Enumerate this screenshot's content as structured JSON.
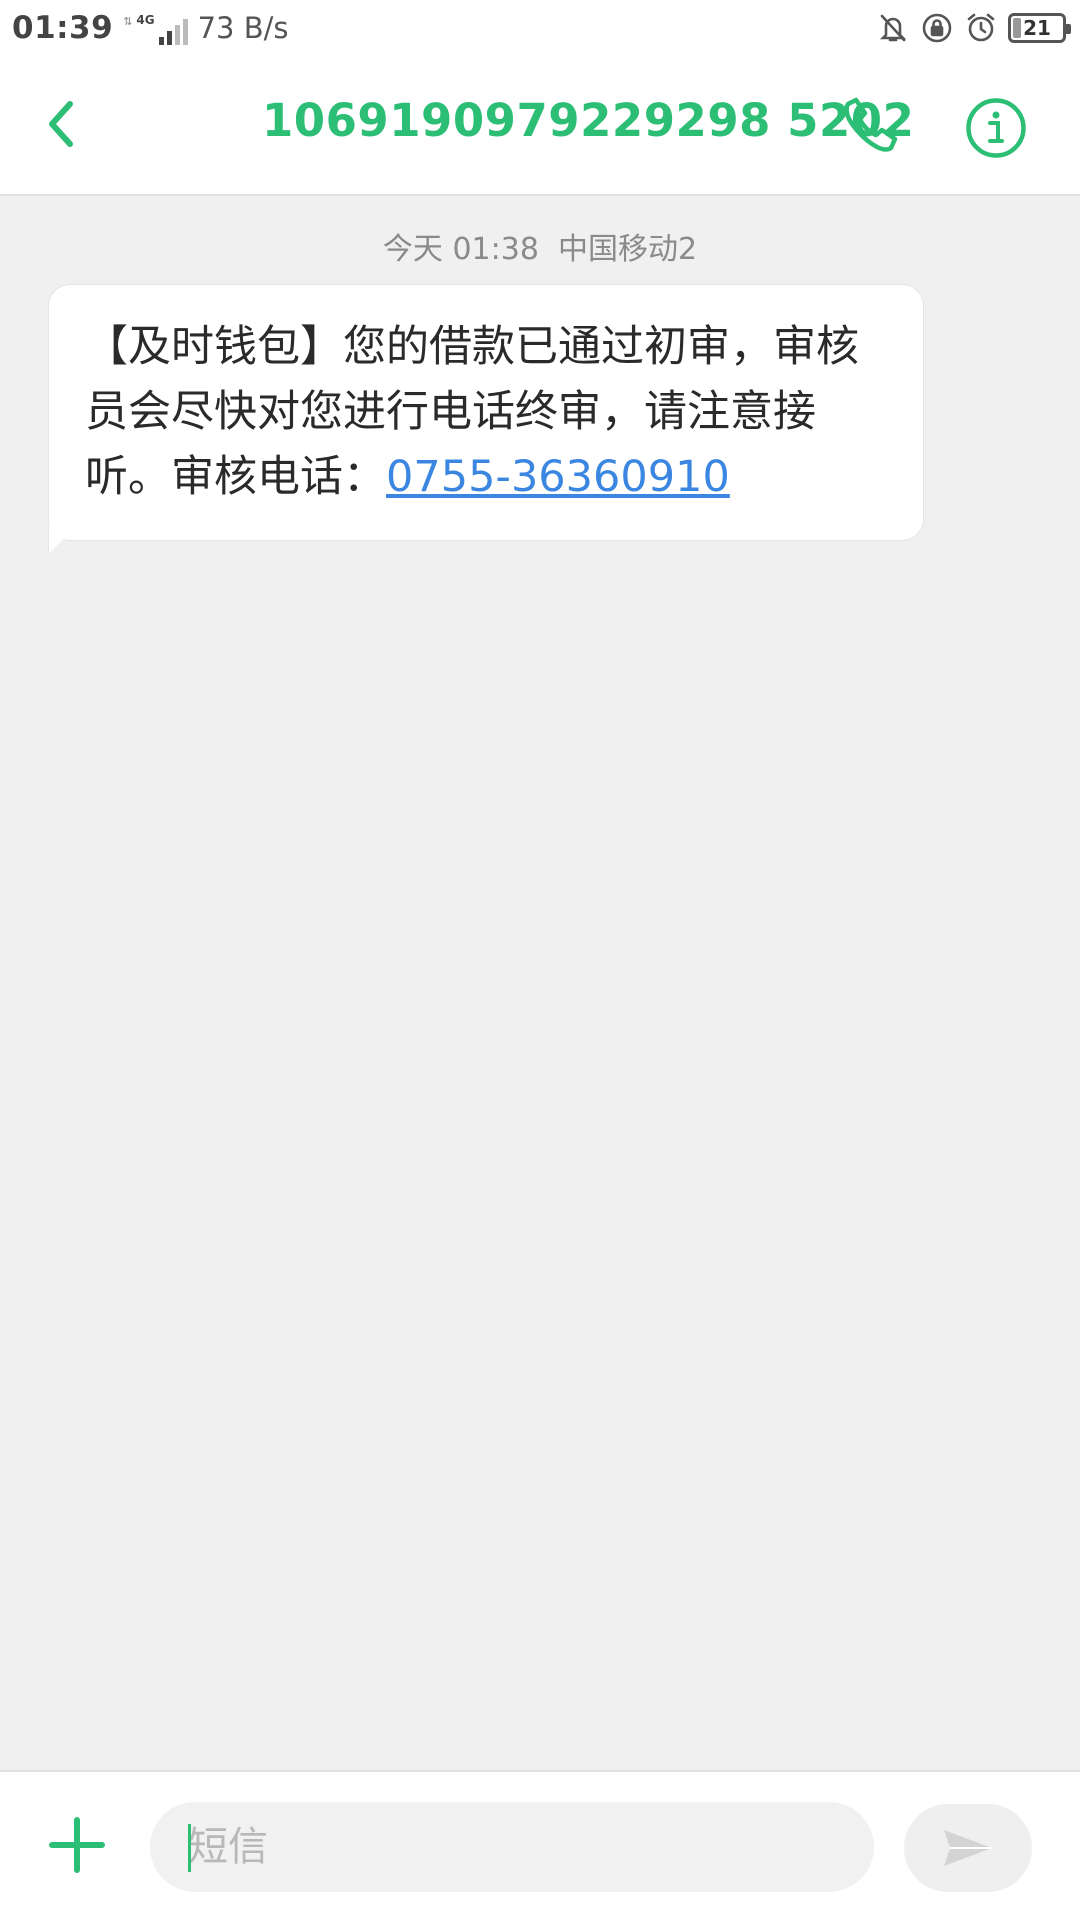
{
  "status_bar": {
    "time": "01:39",
    "network_type": "4G",
    "speed": "73 B/s",
    "battery": "21",
    "icons": [
      "mute-icon",
      "rotation-lock-icon",
      "alarm-icon",
      "battery-icon"
    ]
  },
  "header": {
    "title": "1069190979229298 5202",
    "back_icon": "chevron-left-icon",
    "call_icon": "phone-icon",
    "info_icon": "info-icon",
    "accent_color": "#2dbe76"
  },
  "conversation": {
    "meta": "今天 01:38  中国移动2",
    "messages": [
      {
        "text": "【及时钱包】您的借款已通过初审，审核员会尽快对您进行电话终审，请注意接听。审核电话：",
        "link": "0755-36360910"
      }
    ],
    "link_color": "#3a86e0"
  },
  "composer": {
    "placeholder": "短信",
    "add_icon": "plus-icon",
    "send_icon": "send-icon"
  }
}
